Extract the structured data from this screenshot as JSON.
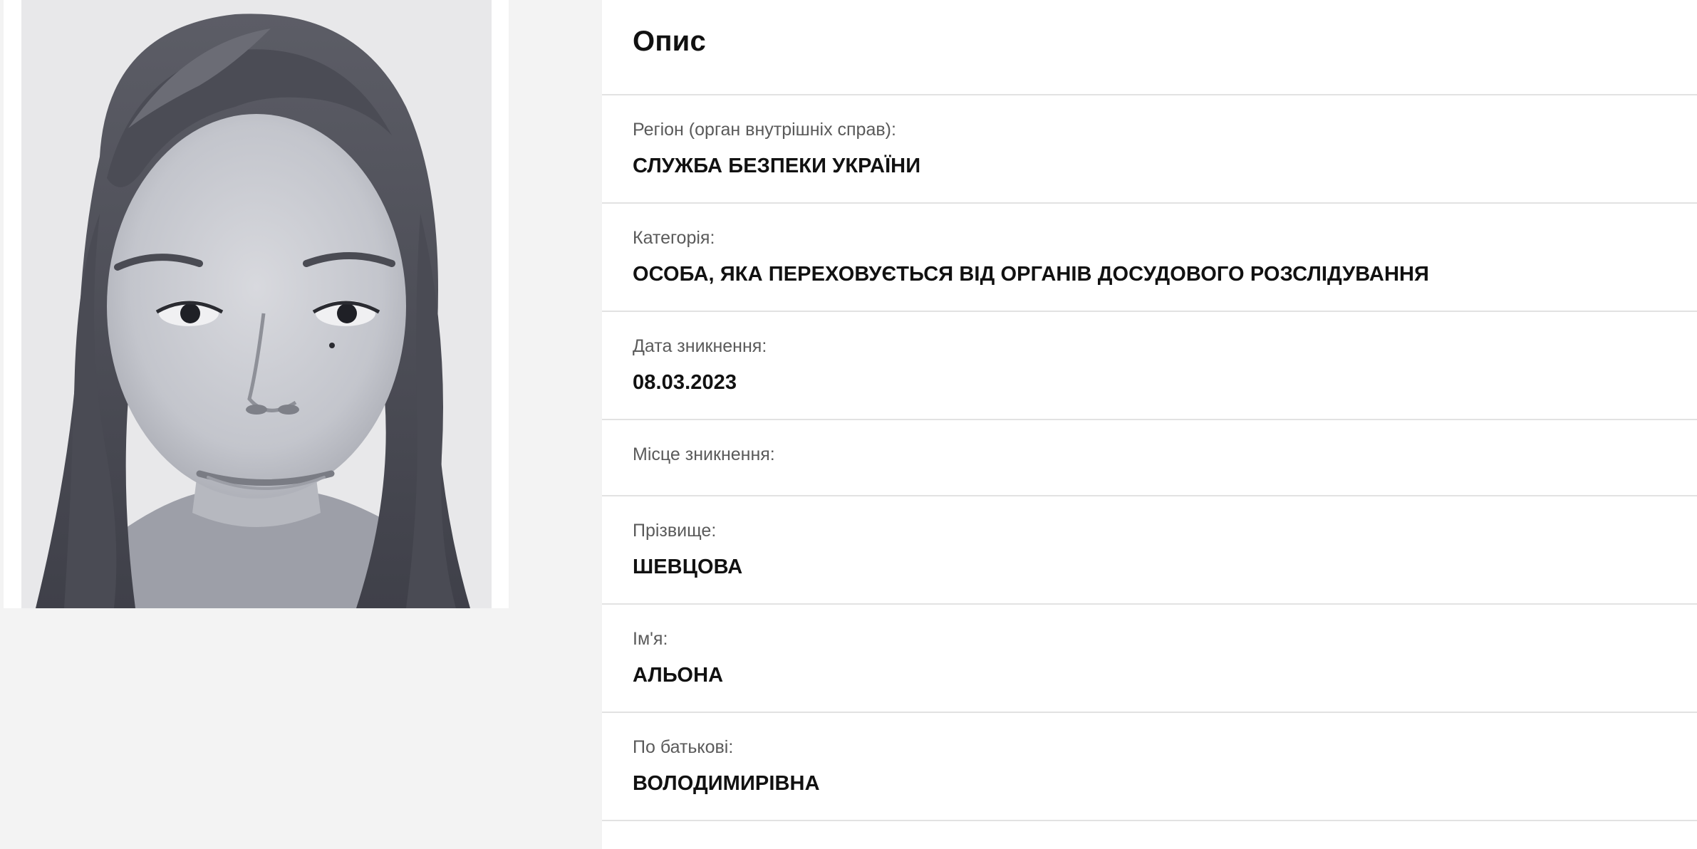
{
  "description": {
    "title": "Опис",
    "fields": [
      {
        "label": "Регіон (орган внутрішніх справ):",
        "value": "СЛУЖБА БЕЗПЕКИ УКРАЇНИ"
      },
      {
        "label": "Категорія:",
        "value": "ОСОБА, ЯКА ПЕРЕХОВУЄТЬСЯ ВІД ОРГАНІВ ДОСУДОВОГО РОЗСЛІДУВАННЯ"
      },
      {
        "label": "Дата зникнення:",
        "value": "08.03.2023"
      },
      {
        "label": "Місце зникнення:",
        "value": ""
      },
      {
        "label": "Прізвище:",
        "value": "ШЕВЦОВА"
      },
      {
        "label": "Ім'я:",
        "value": "АЛЬОНА"
      },
      {
        "label": "По батькові:",
        "value": "ВОЛОДИМИРІВНА"
      }
    ]
  },
  "colors": {
    "page_background": "#f3f3f3",
    "panel_background": "#ffffff",
    "divider": "#e2e2e2",
    "label_text": "#5a5a5a",
    "value_text": "#111111"
  },
  "icons": {
    "photo": "person-photo"
  }
}
